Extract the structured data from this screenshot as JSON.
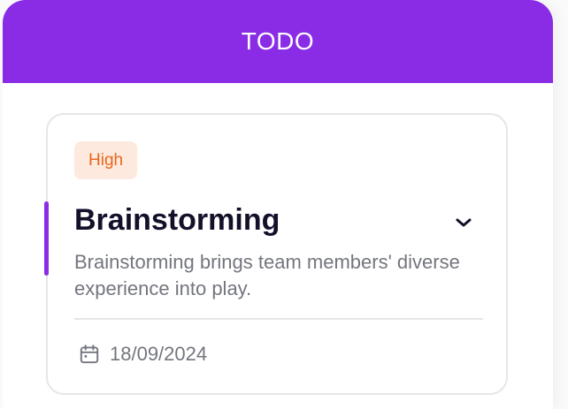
{
  "column": {
    "title": "TODO",
    "accent_color": "#8a2be6"
  },
  "card": {
    "priority": "High",
    "title": "Brainstorming",
    "description": "Brainstorming brings team members' diverse experience into play.",
    "date": "18/09/2024",
    "expand_icon": "chevron-down-icon",
    "date_icon": "calendar-icon"
  }
}
